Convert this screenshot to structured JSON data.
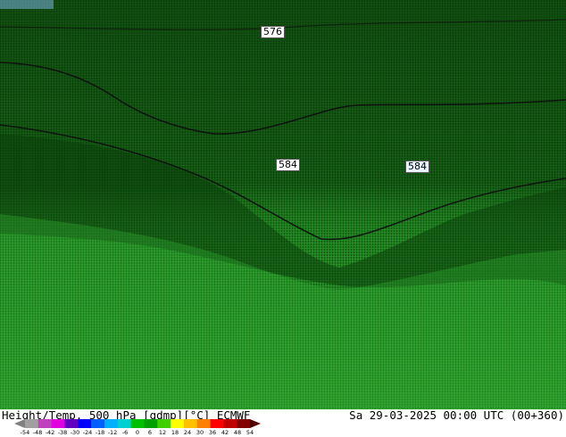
{
  "map": {
    "contour_labels": [
      {
        "text": "576",
        "style": "plain"
      },
      {
        "text": "584",
        "style": "plain"
      },
      {
        "text": "584",
        "style": "highlight"
      }
    ]
  },
  "footer": {
    "title": "Height/Temp. 500 hPa [gdmp][°C] ECMWF",
    "valid_time": "Sa 29-03-2025 00:00 UTC (00+360)"
  },
  "colorbar": {
    "ticks": [
      "-54",
      "-48",
      "-42",
      "-38",
      "-30",
      "-24",
      "-18",
      "-12",
      "-6",
      "0",
      "6",
      "12",
      "18",
      "24",
      "30",
      "36",
      "42",
      "48",
      "54"
    ],
    "colors": [
      "#808080",
      "#a0a0a0",
      "#c040c0",
      "#e000e0",
      "#6000c0",
      "#0000ff",
      "#0060ff",
      "#00b0ff",
      "#00d0d0",
      "#00c000",
      "#00a000",
      "#40d000",
      "#ffff00",
      "#ffc000",
      "#ff8000",
      "#ff0000",
      "#c00000",
      "#800000",
      "#500000"
    ]
  }
}
